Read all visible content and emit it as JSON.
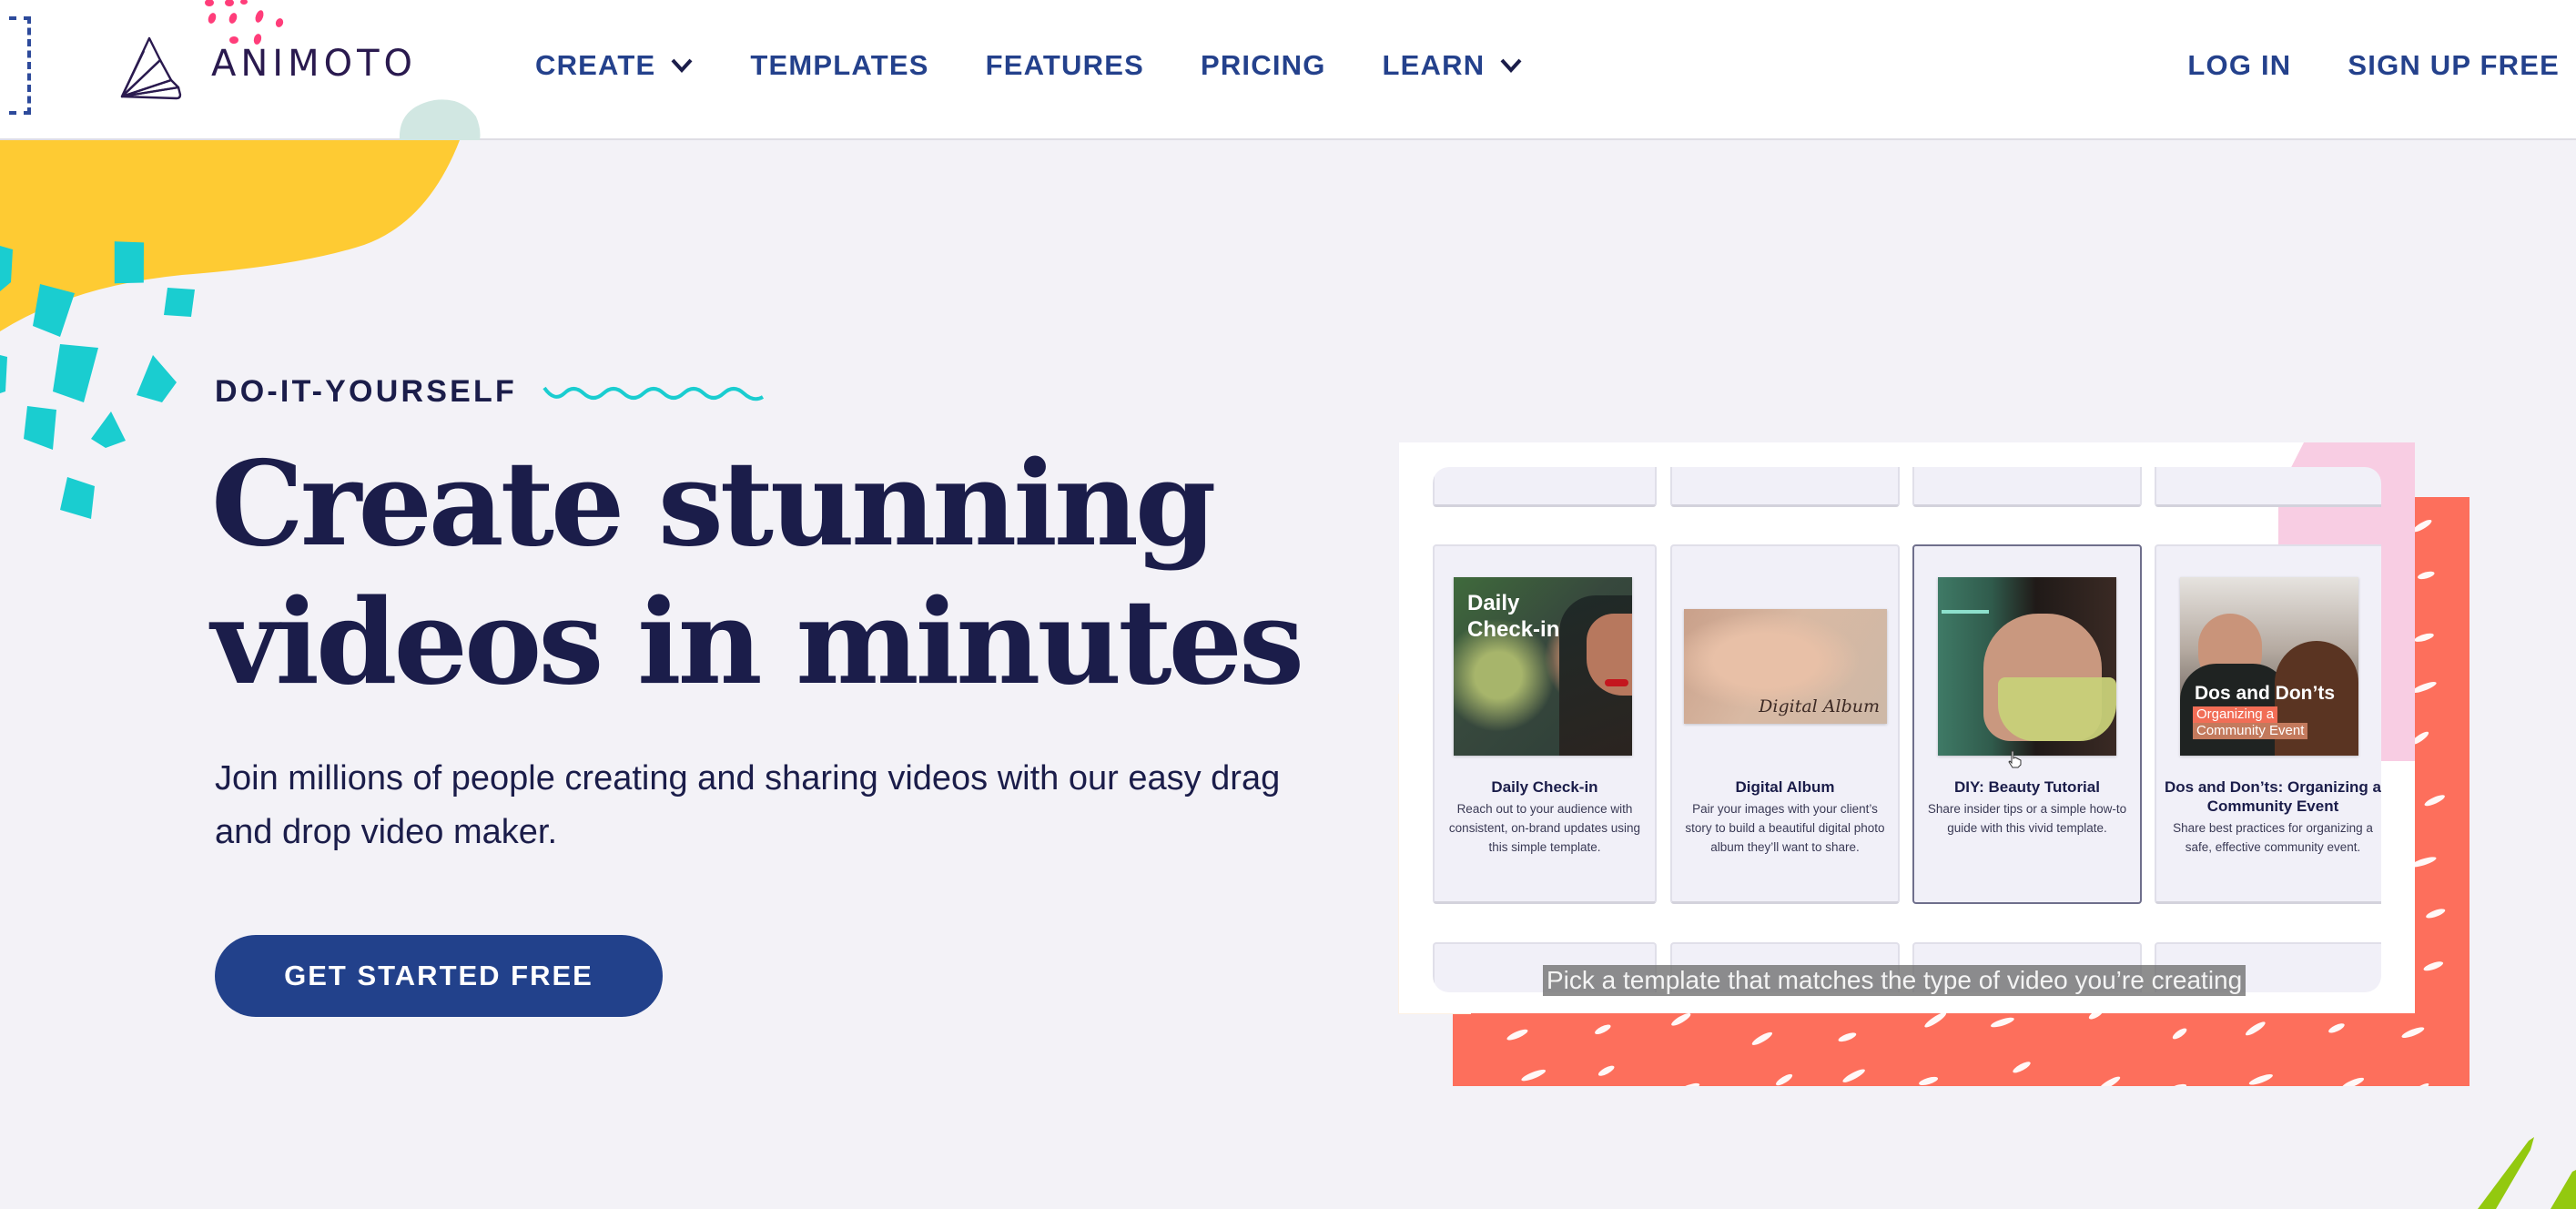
{
  "brand": {
    "name": "ANIMOTO"
  },
  "nav": {
    "items": [
      {
        "label": "CREATE",
        "has_dropdown": true
      },
      {
        "label": "TEMPLATES",
        "has_dropdown": false
      },
      {
        "label": "FEATURES",
        "has_dropdown": false
      },
      {
        "label": "PRICING",
        "has_dropdown": false
      },
      {
        "label": "LEARN",
        "has_dropdown": true
      }
    ],
    "login": "LOG IN",
    "signup": "SIGN UP FREE"
  },
  "hero": {
    "eyebrow": "DO-IT-YOURSELF",
    "headline_line1": "Create stunning",
    "headline_line2": "videos in minutes",
    "subtitle": "Join millions of people creating and sharing videos with our easy drag and drop video maker.",
    "cta": "GET STARTED FREE"
  },
  "templates": {
    "caption": "Pick a template that matches the type of video you’re creating",
    "cards": [
      {
        "title": "Daily Check-in",
        "description": "Reach out to your audience with consistent, on-brand updates using this simple template.",
        "thumb_text": [
          "Daily",
          "Check-in"
        ],
        "selected": false
      },
      {
        "title": "Digital Album",
        "description": "Pair your images with your client’s story to build a beautiful digital photo album they’ll want to share.",
        "thumb_text": [
          "Digital Album"
        ],
        "selected": false
      },
      {
        "title": "DIY: Beauty Tutorial",
        "description": "Share insider tips or a simple how-to guide with this vivid template.",
        "thumb_text": [],
        "selected": true
      },
      {
        "title": "Dos and Don’ts: Organizing a Community Event",
        "description": "Share best practices for organizing a safe, effective community event.",
        "thumb_text": [
          "Dos and Don’ts",
          "Organizing a",
          "Community Event"
        ],
        "selected": false
      }
    ]
  },
  "colors": {
    "brand_navy": "#22418b",
    "text_dark": "#1b1d4a",
    "background": "#f3f2f7",
    "yellow": "#fecb33",
    "teal": "#1acdd0",
    "coral": "#fd6f5c",
    "pink": "#f8cde3",
    "lime": "#93c90f",
    "hot_pink": "#ff3d7a"
  }
}
